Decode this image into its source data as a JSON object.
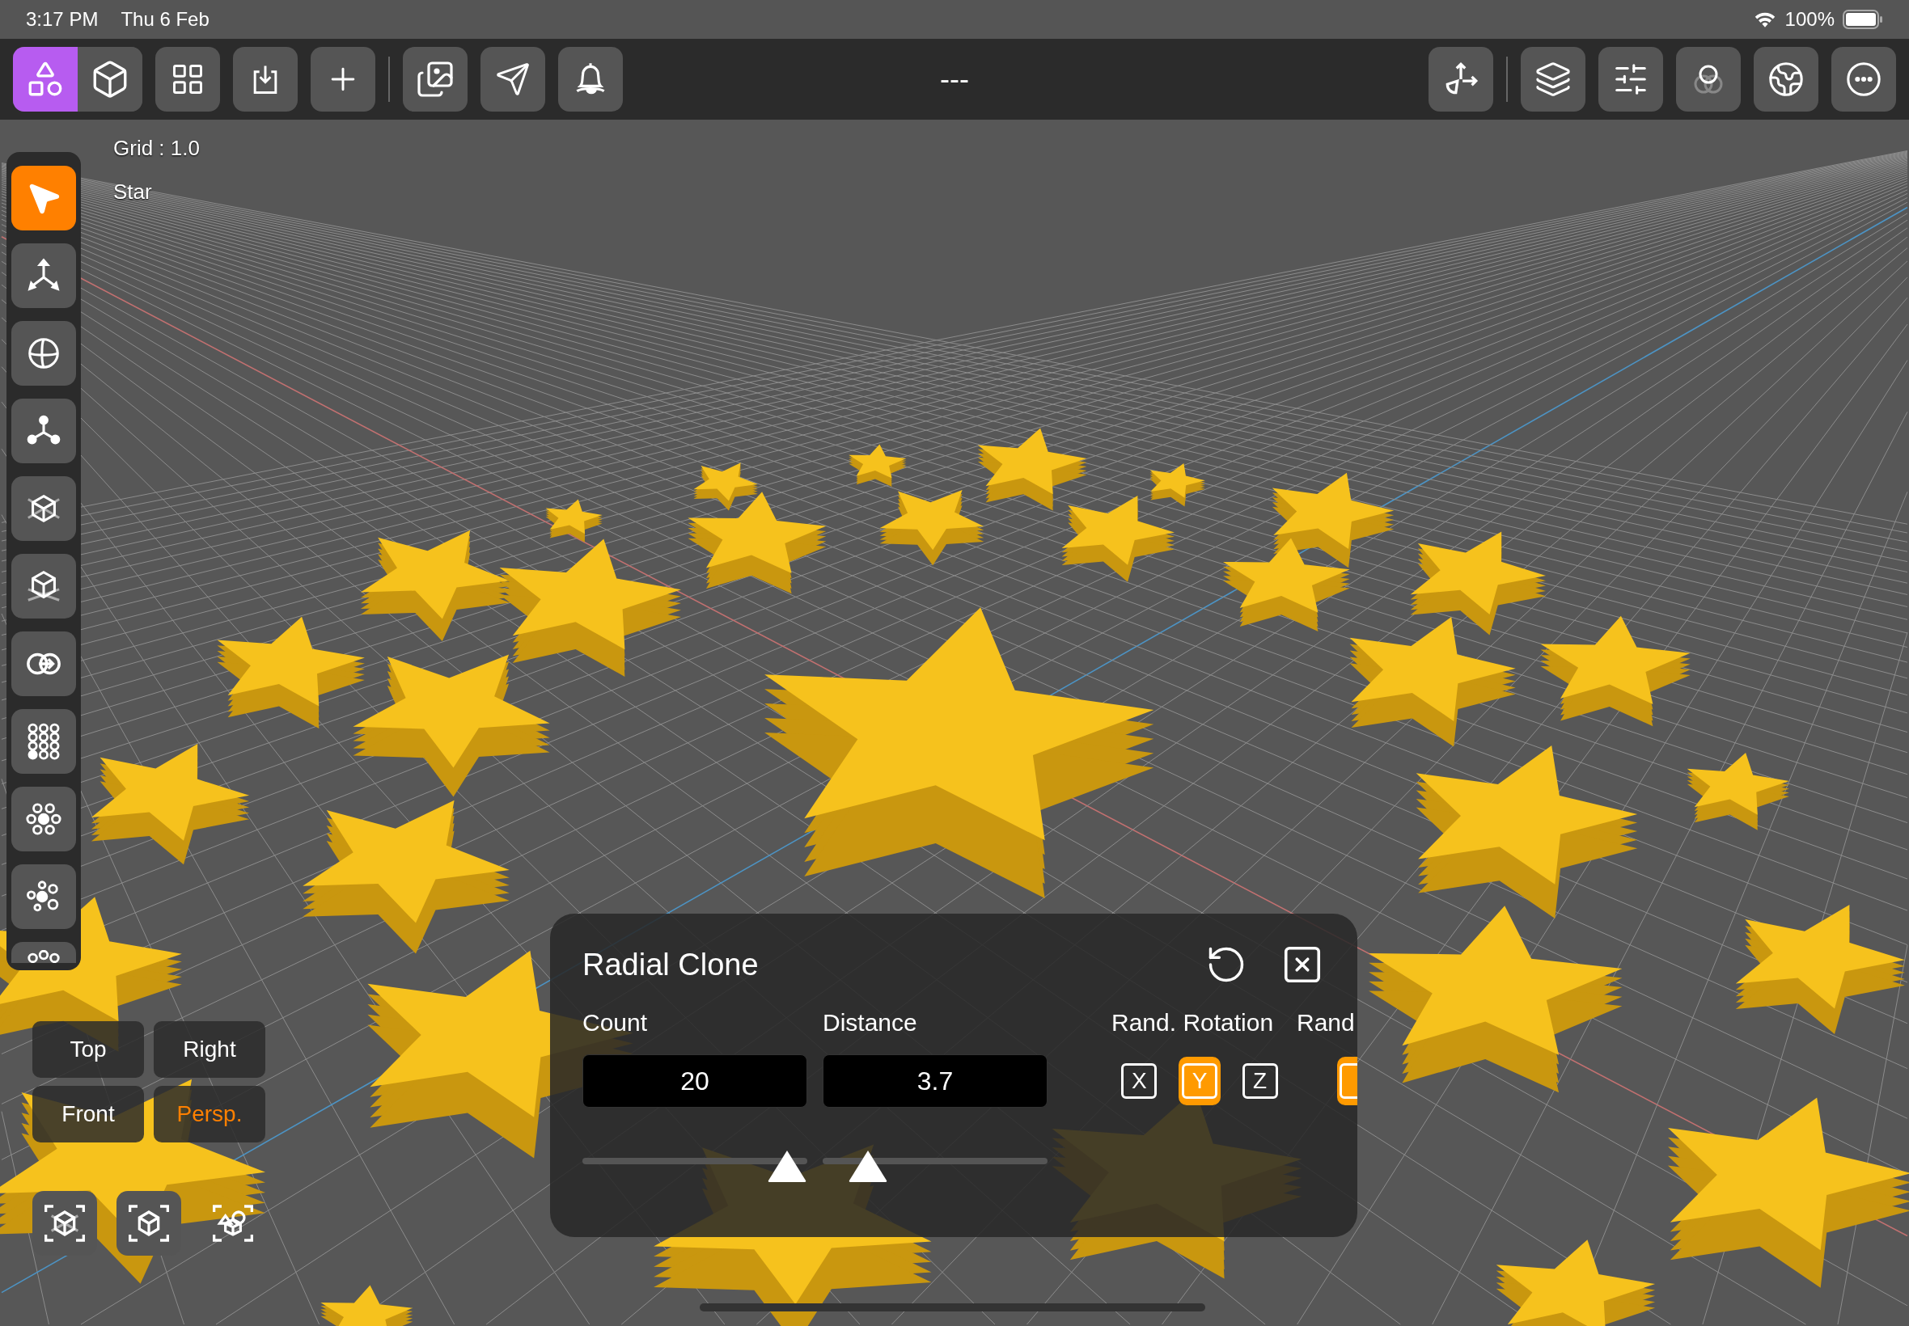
{
  "status_bar": {
    "time": "3:17 PM",
    "date": "Thu 6 Feb",
    "battery": "100%"
  },
  "toolbar": {
    "mode_switch": [
      {
        "selected": true
      },
      {
        "selected": false
      }
    ],
    "title": "---"
  },
  "tools": [
    {
      "selected": true
    },
    {
      "selected": false
    },
    {
      "selected": false
    },
    {
      "selected": false
    },
    {
      "selected": false
    },
    {
      "selected": false
    },
    {
      "selected": false
    },
    {
      "selected": false
    },
    {
      "selected": false
    },
    {
      "selected": false
    },
    {
      "selected": false
    }
  ],
  "viewport": {
    "grid_label": "Grid : 1.0",
    "object_name": "Star"
  },
  "view_buttons": [
    {
      "label": "Top",
      "selected": false
    },
    {
      "label": "Right",
      "selected": false
    },
    {
      "label": "Front",
      "selected": false
    },
    {
      "label": "Persp.",
      "selected": true
    }
  ],
  "panel": {
    "title": "Radial Clone",
    "fields": [
      {
        "label": "Count",
        "value": "20",
        "level": 0.91
      },
      {
        "label": "Distance",
        "value": "3.7",
        "level": 0.2
      }
    ],
    "rotation": {
      "label": "Rand. Rotation",
      "axes": [
        {
          "label": "X",
          "selected": false
        },
        {
          "label": "Y",
          "selected": true
        },
        {
          "label": "Z",
          "selected": false
        }
      ]
    },
    "next_section": {
      "label": "Rand",
      "axes": [
        {
          "selected": true
        }
      ]
    }
  }
}
